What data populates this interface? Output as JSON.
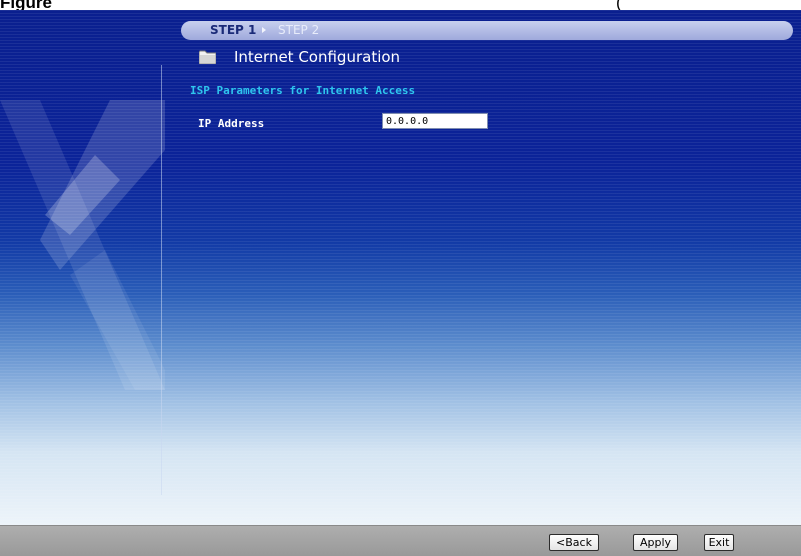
{
  "caption": {
    "left_text": "Figure",
    "right_text": "("
  },
  "wizard": {
    "steps": [
      {
        "label": "STEP 1",
        "active": true
      },
      {
        "label": "STEP 2",
        "active": false
      }
    ],
    "step_separator_icon": "right-arrow-icon"
  },
  "section": {
    "icon": "folder-icon",
    "title": "Internet Configuration"
  },
  "isp": {
    "heading": "ISP Parameters for Internet Access",
    "ip_address_label": "IP Address",
    "ip_address_value": "0.0.0.0"
  },
  "buttons": {
    "back": "<Back",
    "apply": "Apply",
    "exit": "Exit"
  },
  "colors": {
    "background_top": "#0a1f8f",
    "heading_accent": "#2ec6ee",
    "bottom_bar": "#a4a4a4"
  }
}
